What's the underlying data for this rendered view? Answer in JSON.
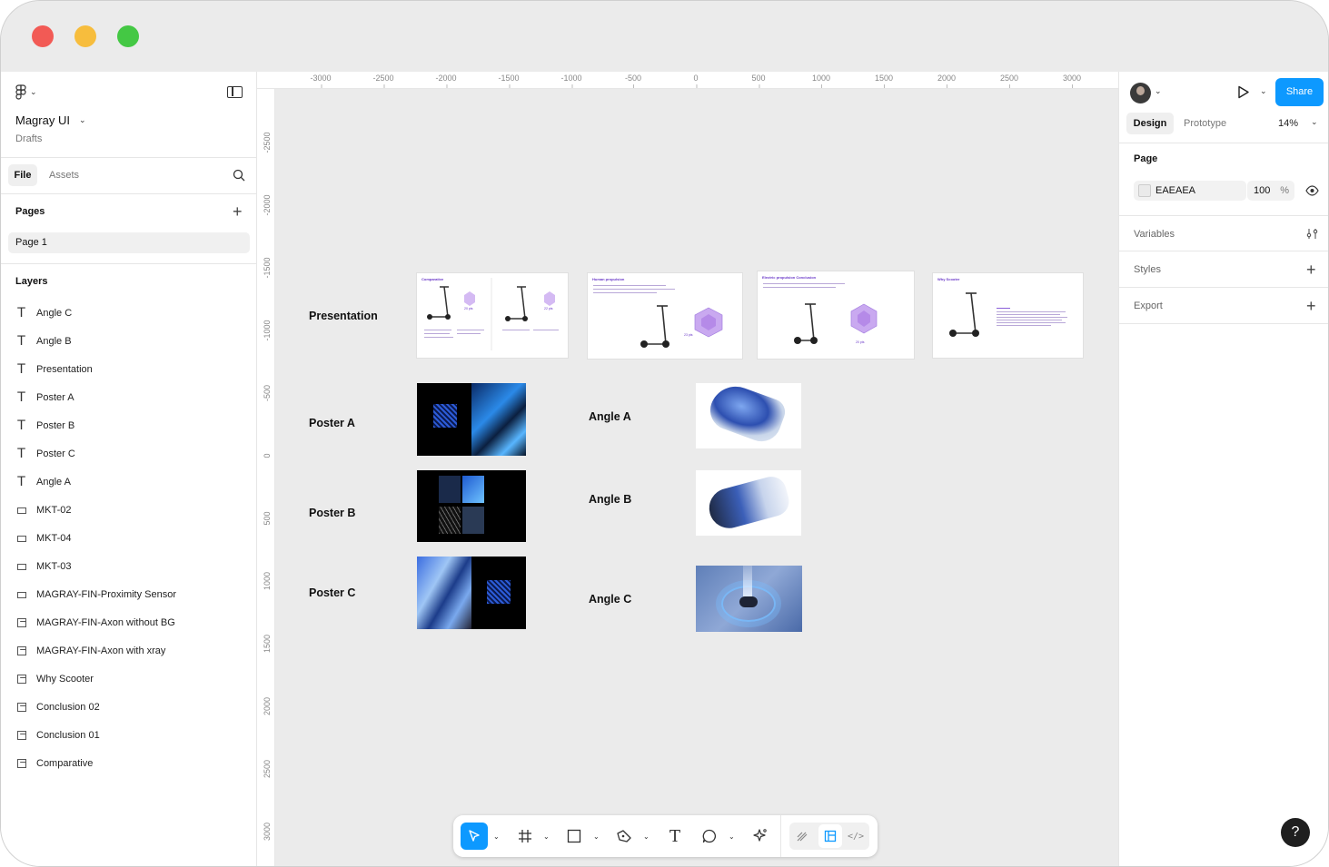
{
  "window": {
    "traffic_lights": [
      "close",
      "minimize",
      "maximize"
    ],
    "colors": {
      "close": "#f25a55",
      "minimize": "#f7bd3d",
      "maximize": "#44c844",
      "accent": "#0d99ff",
      "canvas_bg": "#ebebeb"
    }
  },
  "left_panel": {
    "file_name": "Magray UI",
    "location": "Drafts",
    "tabs": {
      "file": "File",
      "assets": "Assets"
    },
    "pages_heading": "Pages",
    "pages": [
      {
        "label": "Page 1"
      }
    ],
    "layers_heading": "Layers",
    "layers": [
      {
        "label": "Angle C",
        "icon": "text-icon"
      },
      {
        "label": "Angle B",
        "icon": "text-icon"
      },
      {
        "label": "Presentation",
        "icon": "text-icon"
      },
      {
        "label": "Poster A",
        "icon": "text-icon"
      },
      {
        "label": "Poster B",
        "icon": "text-icon"
      },
      {
        "label": "Poster C",
        "icon": "text-icon"
      },
      {
        "label": "Angle A",
        "icon": "text-icon"
      },
      {
        "label": "MKT-02",
        "icon": "frame-icon"
      },
      {
        "label": "MKT-04",
        "icon": "frame-icon"
      },
      {
        "label": "MKT-03",
        "icon": "frame-icon"
      },
      {
        "label": "MAGRAY-FIN-Proximity Sensor",
        "icon": "frame-icon"
      },
      {
        "label": "MAGRAY-FIN-Axon without BG",
        "icon": "image-icon"
      },
      {
        "label": "MAGRAY-FIN-Axon with xray",
        "icon": "image-icon"
      },
      {
        "label": "Why Scooter",
        "icon": "image-icon"
      },
      {
        "label": "Conclusion 02",
        "icon": "image-icon"
      },
      {
        "label": "Conclusion 01",
        "icon": "image-icon"
      },
      {
        "label": "Comparative",
        "icon": "image-icon"
      }
    ]
  },
  "rulers": {
    "top": [
      "-3000",
      "-2500",
      "-2000",
      "-1500",
      "-1000",
      "-500",
      "0",
      "500",
      "1000",
      "1500",
      "2000",
      "2500",
      "3000"
    ],
    "left": [
      "-2500",
      "-2000",
      "-1500",
      "-1000",
      "-500",
      "0",
      "500",
      "1000",
      "1500",
      "2000",
      "2500",
      "3000"
    ]
  },
  "canvas": {
    "labels": {
      "presentation": "Presentation",
      "poster_a": "Poster A",
      "poster_b": "Poster B",
      "poster_c": "Poster C",
      "angle_a": "Angle A",
      "angle_b": "Angle B",
      "angle_c": "Angle C"
    },
    "slides": [
      {
        "title": "Comparative"
      },
      {
        "title": "Human propulsion"
      },
      {
        "title": "Electric propulsion Conclusion"
      },
      {
        "title": "Why Scooter"
      }
    ],
    "slide_texts": {
      "s1a": "20 pts",
      "s1b": "22 pts",
      "s2": "23 pts",
      "s3": "20 pts"
    }
  },
  "toolbar": {
    "tools": [
      "move-tool",
      "frame-tool",
      "shape-tool",
      "pen-tool",
      "text-tool",
      "comment-tool",
      "actions-tool",
      "draw-mode",
      "design-mode",
      "dev-mode"
    ]
  },
  "right_panel": {
    "share_label": "Share",
    "tabs": {
      "design": "Design",
      "prototype": "Prototype"
    },
    "zoom": "14%",
    "page_heading": "Page",
    "page_color": "EAEAEA",
    "page_opacity": "100",
    "opacity_unit": "%",
    "variables_label": "Variables",
    "styles_label": "Styles",
    "export_label": "Export",
    "help_label": "?"
  }
}
